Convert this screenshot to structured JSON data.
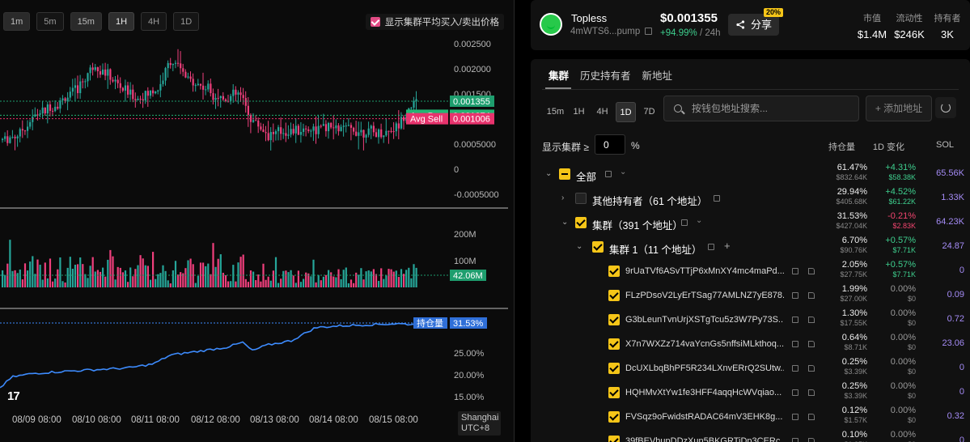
{
  "chart": {
    "timeframes": [
      "1m",
      "5m",
      "15m",
      "1H",
      "4H",
      "1D"
    ],
    "active_timeframe": "1H",
    "overlay_checkbox_label": "显示集群平均买入/卖出价格",
    "price_axis": [
      "0.002500",
      "0.002000",
      "0.001500",
      "0.001000",
      "0.0005000",
      "0",
      "-0.0005000"
    ],
    "price_tags": {
      "last": "0.001355",
      "avg_buy_label": "Avg Buy",
      "avg_buy": "0.001074",
      "avg_sell_label": "Avg Sell",
      "avg_sell": "0.001006"
    },
    "volume_axis": [
      "200M",
      "100M"
    ],
    "volume_tag": "42.06M",
    "holding_axis": [
      "25.00%",
      "20.00%",
      "15.00%"
    ],
    "holding_tag_label": "持仓量",
    "holding_tag_value": "31.53%",
    "dates": [
      "08/09 08:00",
      "08/10 08:00",
      "08/11 08:00",
      "08/12 08:00",
      "08/13 08:00",
      "08/14 08:00",
      "08/15 08:00"
    ],
    "timezone_line1": "Shanghai",
    "timezone_line2": "UTC+8",
    "logo_text": "17",
    "colors": {
      "up": "#26a69a",
      "down": "#ef3f7c",
      "holding_line": "#3d8bfd",
      "avg_buy": "#22b573",
      "avg_sell": "#e8336d"
    }
  },
  "token": {
    "name": "Topless",
    "address": "4mWTS6...pump",
    "price": "$0.001355",
    "change": "+94.99%",
    "change_period": "/ 24h",
    "share_label": "分享",
    "share_badge": "20%",
    "stats": [
      {
        "label": "市值",
        "value": "$1.4M"
      },
      {
        "label": "流动性",
        "value": "$246K"
      },
      {
        "label": "持有者",
        "value": "3K"
      }
    ]
  },
  "panel": {
    "tabs": [
      "集群",
      "历史持有者",
      "新地址"
    ],
    "periods": [
      "15m",
      "1H",
      "4H",
      "1D",
      "7D"
    ],
    "active_period": "1D",
    "search_placeholder": "按钱包地址搜索...",
    "add_label": "+ 添加地址",
    "filter_label": "显示集群 ≥",
    "filter_value": "0",
    "filter_unit": "%",
    "columns": {
      "holding": "持仓量",
      "change": "1D 变化",
      "sol": "SOL"
    },
    "rows": [
      {
        "name": "全部",
        "holding": "61.47%",
        "holding_usd": "$832.64K",
        "change": "+4.31%",
        "change_usd": "$58.38K",
        "dir": "pos",
        "sol": "65.56K"
      },
      {
        "name": "其他持有者（61 个地址）",
        "holding": "29.94%",
        "holding_usd": "$405.68K",
        "change": "+4.52%",
        "change_usd": "$61.22K",
        "dir": "pos",
        "sol": "1.33K"
      },
      {
        "name": "集群（391 个地址）",
        "holding": "31.53%",
        "holding_usd": "$427.04K",
        "change": "-0.21%",
        "change_usd": "$2.83K",
        "dir": "neg",
        "sol": "64.23K"
      },
      {
        "name": "集群 1（11 个地址）",
        "holding": "6.70%",
        "holding_usd": "$90.76K",
        "change": "+0.57%",
        "change_usd": "$7.71K",
        "dir": "pos",
        "sol": "24.87"
      },
      {
        "name": "9rUaTVf6ASvTTjP6xMnXY4mc4maPd...",
        "holding": "2.05%",
        "holding_usd": "$27.75K",
        "change": "+0.57%",
        "change_usd": "$7.71K",
        "dir": "pos",
        "sol": "0"
      },
      {
        "name": "FLzPDsoV2LyErTSag77AMLNZ7yE878...",
        "holding": "1.99%",
        "holding_usd": "$27.00K",
        "change": "0.00%",
        "change_usd": "$0",
        "dir": "zero",
        "sol": "0.09"
      },
      {
        "name": "G3bLeunTvnUrjXSTgTcu5z3W7Py73S...",
        "holding": "1.30%",
        "holding_usd": "$17.55K",
        "change": "0.00%",
        "change_usd": "$0",
        "dir": "zero",
        "sol": "0.72"
      },
      {
        "name": "X7n7WXZz714vaYcnGs5nffsiMLkthoq...",
        "holding": "0.64%",
        "holding_usd": "$8.71K",
        "change": "0.00%",
        "change_usd": "$0",
        "dir": "zero",
        "sol": "23.06"
      },
      {
        "name": "DcUXLbqBhPF5R234LXnvERrQ2SUtw...",
        "holding": "0.25%",
        "holding_usd": "$3.39K",
        "change": "0.00%",
        "change_usd": "$0",
        "dir": "zero",
        "sol": "0"
      },
      {
        "name": "HQHMvXtYw1fe3HFF4aqqHcWVqiao...",
        "holding": "0.25%",
        "holding_usd": "$3.39K",
        "change": "0.00%",
        "change_usd": "$0",
        "dir": "zero",
        "sol": "0"
      },
      {
        "name": "FVSqz9oFwidstRADAC64mV3EHK8g...",
        "holding": "0.12%",
        "holding_usd": "$1.57K",
        "change": "0.00%",
        "change_usd": "$0",
        "dir": "zero",
        "sol": "0.32"
      },
      {
        "name": "39fBEVhupDDzXun5BKGRTiDp3CERc...",
        "holding": "0.10%",
        "holding_usd": "$1.35K",
        "change": "0.00%",
        "change_usd": "$0",
        "dir": "zero",
        "sol": "0"
      }
    ]
  }
}
